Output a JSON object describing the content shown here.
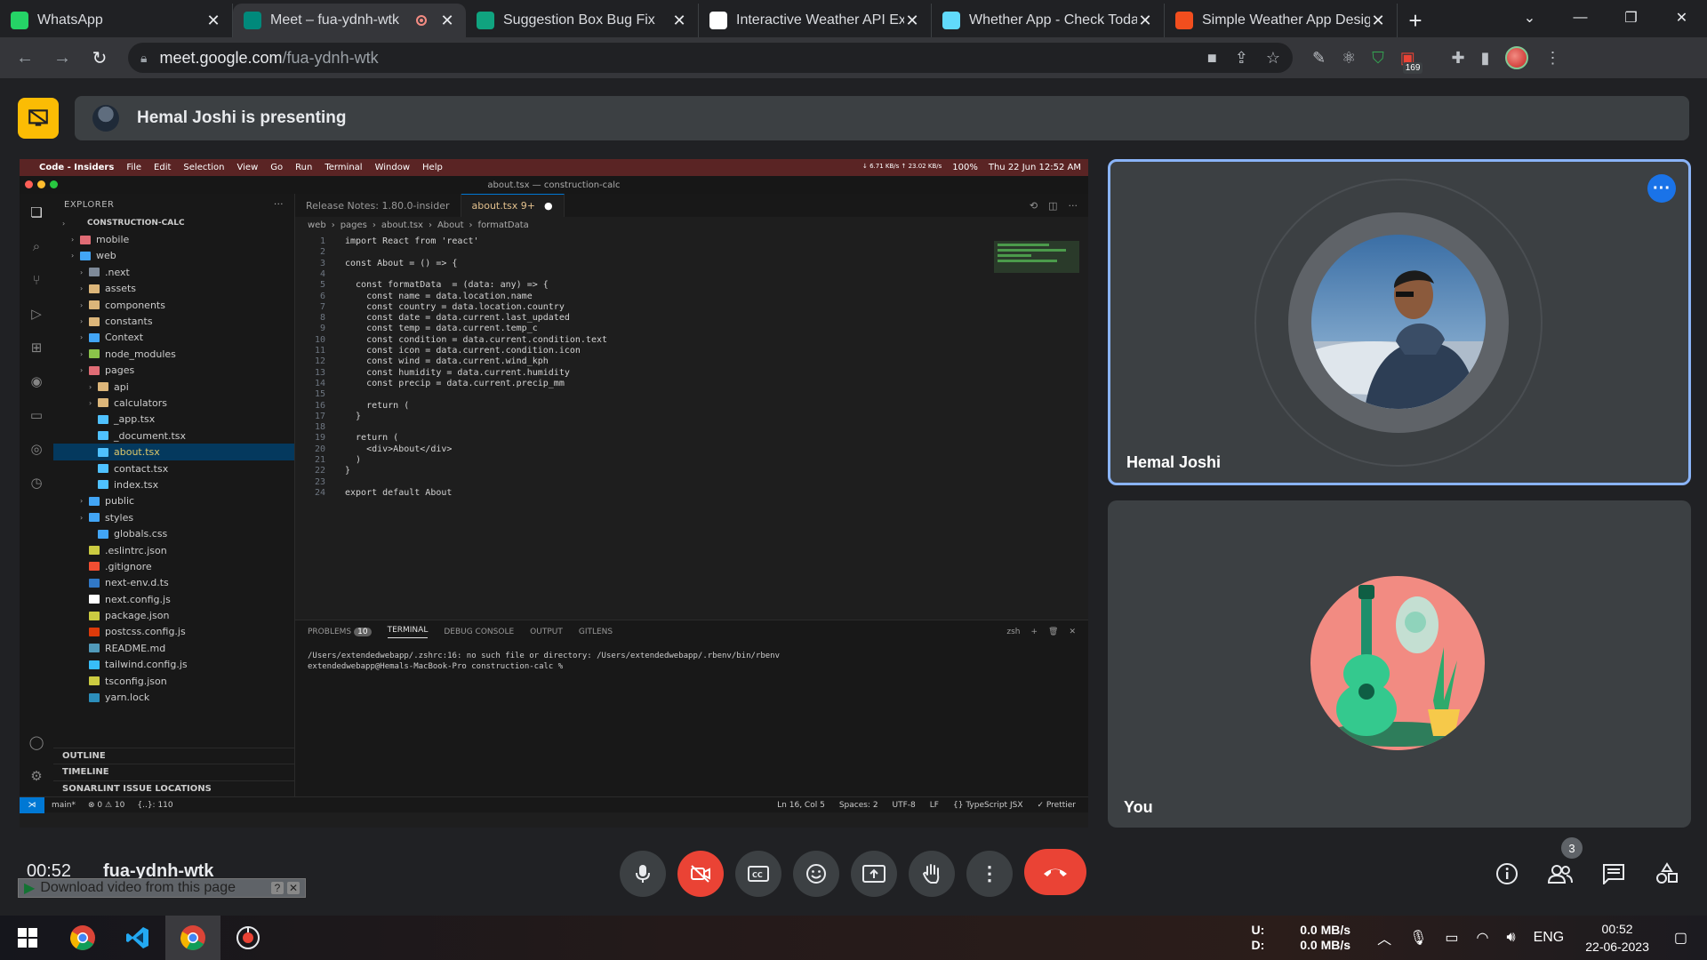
{
  "browser": {
    "tabs": [
      {
        "title": "WhatsApp",
        "icon": "whatsapp-icon",
        "color": "#25d366"
      },
      {
        "title": "Meet – fua-ydnh-wtk",
        "icon": "meet-icon",
        "color": "#00897b"
      },
      {
        "title": "Suggestion Box Bug Fix",
        "icon": "chatgpt-icon",
        "color": "#10a37f"
      },
      {
        "title": "Interactive Weather API Exp",
        "icon": "document-icon",
        "color": "#ffffff"
      },
      {
        "title": "Whether App - Check Toda",
        "icon": "react-icon",
        "color": "#61dafb"
      },
      {
        "title": "Simple Weather App Desig",
        "icon": "figma-icon",
        "color": "#f24e1e"
      }
    ],
    "url_host": "meet.google.com",
    "url_path": "/fua-ydnh-wtk",
    "extension_badge": "169"
  },
  "meet": {
    "presenting_text": "Hemal Joshi is presenting",
    "participants": [
      {
        "name": "Hemal Joshi"
      },
      {
        "name": "You"
      }
    ],
    "time": "00:52",
    "meeting_code": "fua-ydnh-wtk",
    "download_bar": "Download video from this page",
    "participant_count": "3",
    "accent": "#8ab4f8",
    "danger": "#ea4335"
  },
  "vscode": {
    "menubar": [
      "Code - Insiders",
      "File",
      "Edit",
      "Selection",
      "View",
      "Go",
      "Run",
      "Terminal",
      "Window",
      "Help"
    ],
    "menubar_right": [
      "100%",
      "Thu 22 Jun  12:52 AM"
    ],
    "net_speed": "↓ 6.71 KB/s ↑ 23.02 KB/s",
    "window_title": "about.tsx — construction-calc",
    "explorer_title": "EXPLORER",
    "files": [
      {
        "label": "CONSTRUCTION-CALC",
        "indent": 0,
        "kind": "root"
      },
      {
        "label": "mobile",
        "indent": 1,
        "kind": "folder-red"
      },
      {
        "label": "web",
        "indent": 1,
        "kind": "folder-blue"
      },
      {
        "label": ".next",
        "indent": 2,
        "kind": "folder-gray"
      },
      {
        "label": "assets",
        "indent": 2,
        "kind": "folder"
      },
      {
        "label": "components",
        "indent": 2,
        "kind": "folder"
      },
      {
        "label": "constants",
        "indent": 2,
        "kind": "folder"
      },
      {
        "label": "Context",
        "indent": 2,
        "kind": "folder-blue"
      },
      {
        "label": "node_modules",
        "indent": 2,
        "kind": "folder-green"
      },
      {
        "label": "pages",
        "indent": 2,
        "kind": "folder-red"
      },
      {
        "label": "api",
        "indent": 3,
        "kind": "folder"
      },
      {
        "label": "calculators",
        "indent": 3,
        "kind": "folder"
      },
      {
        "label": "_app.tsx",
        "indent": 3,
        "kind": "tsx"
      },
      {
        "label": "_document.tsx",
        "indent": 3,
        "kind": "tsx"
      },
      {
        "label": "about.tsx",
        "indent": 3,
        "kind": "tsx",
        "selected": true
      },
      {
        "label": "contact.tsx",
        "indent": 3,
        "kind": "tsx"
      },
      {
        "label": "index.tsx",
        "indent": 3,
        "kind": "tsx"
      },
      {
        "label": "public",
        "indent": 2,
        "kind": "folder-blue"
      },
      {
        "label": "styles",
        "indent": 2,
        "kind": "folder-blue"
      },
      {
        "label": "globals.css",
        "indent": 3,
        "kind": "css"
      },
      {
        "label": ".eslintrc.json",
        "indent": 2,
        "kind": "json"
      },
      {
        "label": ".gitignore",
        "indent": 2,
        "kind": "git"
      },
      {
        "label": "next-env.d.ts",
        "indent": 2,
        "kind": "ts"
      },
      {
        "label": "next.config.js",
        "indent": 2,
        "kind": "next"
      },
      {
        "label": "package.json",
        "indent": 2,
        "kind": "json"
      },
      {
        "label": "postcss.config.js",
        "indent": 2,
        "kind": "postcss"
      },
      {
        "label": "README.md",
        "indent": 2,
        "kind": "md"
      },
      {
        "label": "tailwind.config.js",
        "indent": 2,
        "kind": "tailwind"
      },
      {
        "label": "tsconfig.json",
        "indent": 2,
        "kind": "json"
      },
      {
        "label": "yarn.lock",
        "indent": 2,
        "kind": "yarn"
      }
    ],
    "sections": [
      "OUTLINE",
      "TIMELINE",
      "SONARLINT ISSUE LOCATIONS"
    ],
    "editor_tabs": [
      "Release Notes: 1.80.0-insider",
      "about.tsx 9+"
    ],
    "breadcrumbs": [
      "web",
      "pages",
      "about.tsx",
      "About",
      "formatData"
    ],
    "code": [
      "import React from 'react'",
      "",
      "const About = () => {",
      "",
      "  const formatData  = (data: any) => {",
      "    const name = data.location.name",
      "    const country = data.location.country",
      "    const date = data.current.last_updated",
      "    const temp = data.current.temp_c",
      "    const condition = data.current.condition.text",
      "    const icon = data.current.condition.icon",
      "    const wind = data.current.wind_kph",
      "    const humidity = data.current.humidity",
      "    const precip = data.current.precip_mm",
      "",
      "    return (",
      "  }",
      "",
      "  return (",
      "    <div>About</div>",
      "  )",
      "}",
      "",
      "export default About"
    ],
    "panel_tabs": [
      "PROBLEMS",
      "TERMINAL",
      "DEBUG CONSOLE",
      "OUTPUT",
      "GITLENS"
    ],
    "problems_count": "10",
    "terminal_shell": "zsh",
    "terminal_lines": [
      "/Users/extendedwebapp/.zshrc:16: no such file or directory: /Users/extendedwebapp/.rbenv/bin/rbenv",
      "extendedwebapp@Hemals-MacBook-Pro construction-calc %"
    ],
    "status_left": [
      "main*",
      "⊗ 0 ⚠ 10",
      "{..}: 110"
    ],
    "status_right": [
      "Ln 16, Col 5",
      "Spaces: 2",
      "UTF-8",
      "LF",
      "{} TypeScript JSX",
      "✓ Prettier"
    ]
  },
  "taskbar": {
    "upload_label": "U:",
    "download_label": "D:",
    "upload_speed": "0.0 MB/s",
    "download_speed": "0.0 MB/s",
    "language": "ENG",
    "time": "00:52",
    "date": "22-06-2023"
  }
}
